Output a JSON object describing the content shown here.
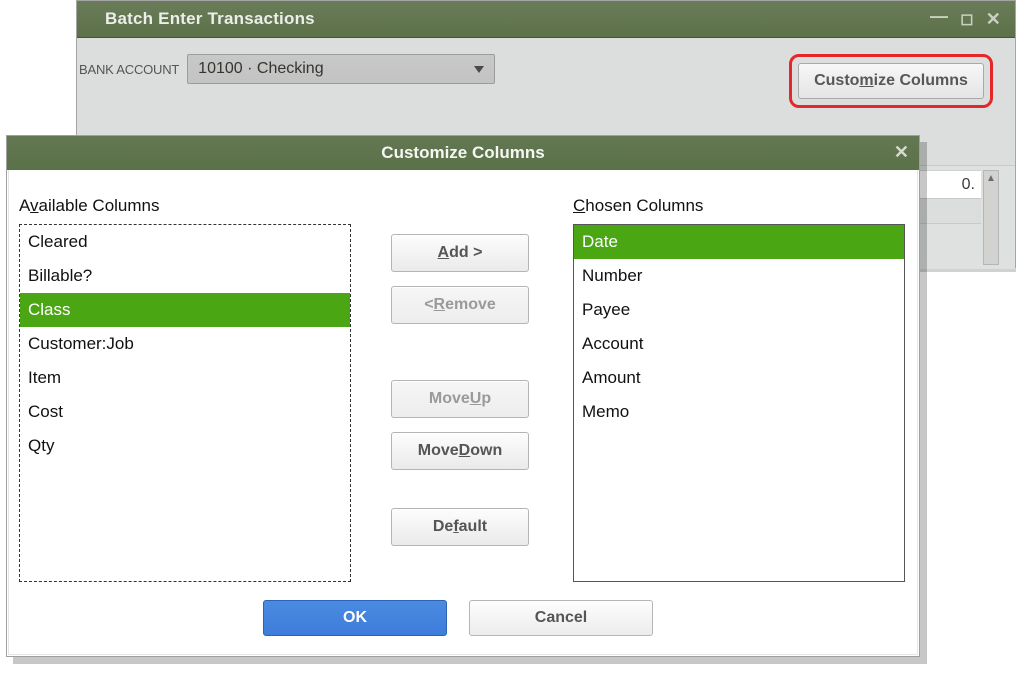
{
  "parentWindow": {
    "title": "Batch Enter Transactions",
    "bankAccountLabel": "BANK ACCOUNT",
    "bankAccountValue": "10100 · Checking",
    "customizeColumnsLabel_pre": "Custo",
    "customizeColumnsLabel_m": "m",
    "customizeColumnsLabel_post": "ize Columns",
    "sampleValue": "0."
  },
  "dialog": {
    "title": "Customize Columns",
    "availableHeading_pre": "A",
    "availableHeading_v": "v",
    "availableHeading_post": "ailable Columns",
    "chosenHeading_pre": "",
    "chosenHeading_c": "C",
    "chosenHeading_post": "hosen Columns",
    "available": [
      {
        "label": "Cleared",
        "selected": false
      },
      {
        "label": "Billable?",
        "selected": false
      },
      {
        "label": "Class",
        "selected": true
      },
      {
        "label": "Customer:Job",
        "selected": false
      },
      {
        "label": "Item",
        "selected": false
      },
      {
        "label": "Cost",
        "selected": false
      },
      {
        "label": "Qty",
        "selected": false
      }
    ],
    "chosen": [
      {
        "label": "Date",
        "selected": true
      },
      {
        "label": "Number",
        "selected": false
      },
      {
        "label": "Payee",
        "selected": false
      },
      {
        "label": "Account",
        "selected": false
      },
      {
        "label": "Amount",
        "selected": false
      },
      {
        "label": "Memo",
        "selected": false
      }
    ],
    "buttons": {
      "add_pre": "",
      "add_ul": "A",
      "add_post": "dd >",
      "remove_pre": "< ",
      "remove_ul": "R",
      "remove_post": "emove",
      "moveup_pre": "Move ",
      "moveup_ul": "U",
      "moveup_post": "p",
      "movedown_pre": "Move ",
      "movedown_ul": "D",
      "movedown_post": "own",
      "default_pre": "De",
      "default_ul": "f",
      "default_post": "ault",
      "ok": "OK",
      "cancel": "Cancel"
    }
  }
}
